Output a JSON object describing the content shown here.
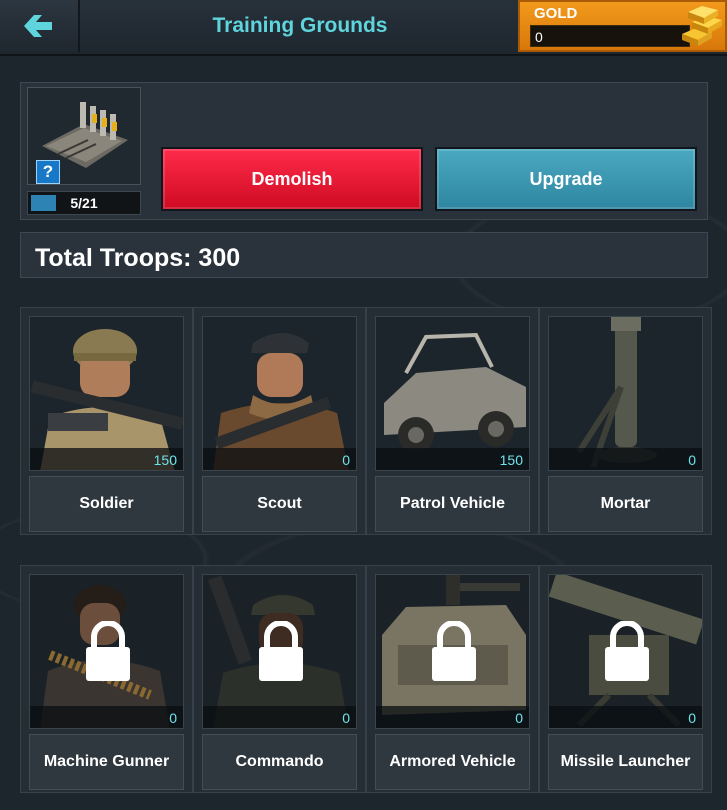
{
  "header": {
    "title": "Training Grounds",
    "gold_label": "GOLD",
    "gold_value": "0"
  },
  "building": {
    "help_label": "?",
    "level_text": "5/21",
    "level_progress": 0.24,
    "demolish_label": "Demolish",
    "upgrade_label": "Upgrade"
  },
  "total_troops": "Total Troops: 300",
  "units": [
    {
      "name": "Soldier",
      "count": "150",
      "locked": false,
      "icon": "soldier-portrait"
    },
    {
      "name": "Scout",
      "count": "0",
      "locked": false,
      "icon": "scout-portrait"
    },
    {
      "name": "Patrol Vehicle",
      "count": "150",
      "locked": false,
      "icon": "patrol-vehicle-image"
    },
    {
      "name": "Mortar",
      "count": "0",
      "locked": false,
      "icon": "mortar-image"
    },
    {
      "name": "Machine Gunner",
      "count": "0",
      "locked": true,
      "icon": "machine-gunner-portrait"
    },
    {
      "name": "Commando",
      "count": "0",
      "locked": true,
      "icon": "commando-portrait"
    },
    {
      "name": "Armored Vehicle",
      "count": "0",
      "locked": true,
      "icon": "armored-vehicle-image"
    },
    {
      "name": "Missile Launcher",
      "count": "0",
      "locked": true,
      "icon": "missile-launcher-image"
    }
  ],
  "colors": {
    "title": "#5fd4dc",
    "demolish": "#e8132f",
    "upgrade": "#3b97b1",
    "gold": "#e88a12",
    "count": "#6ee3ea"
  }
}
